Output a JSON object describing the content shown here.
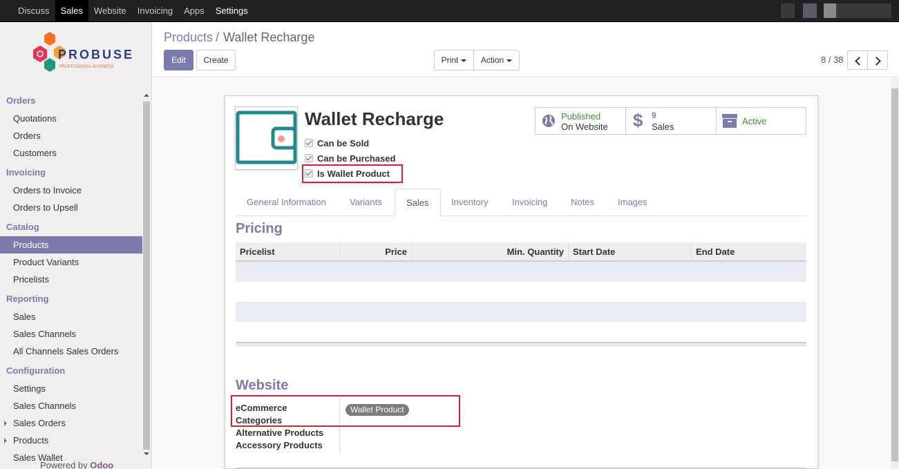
{
  "topbar": {
    "menu": [
      "Discuss",
      "Sales",
      "Website",
      "Invoicing",
      "Apps",
      "Settings"
    ],
    "active": "Sales"
  },
  "logo": {
    "name": "PROBUSE",
    "tagline": "PROFESSIONAL BUSINESS"
  },
  "sidebar": {
    "sections": [
      {
        "title": "Orders",
        "items": [
          "Quotations",
          "Orders",
          "Customers"
        ]
      },
      {
        "title": "Invoicing",
        "items": [
          "Orders to Invoice",
          "Orders to Upsell"
        ]
      },
      {
        "title": "Catalog",
        "items": [
          "Products",
          "Product Variants",
          "Pricelists"
        ]
      },
      {
        "title": "Reporting",
        "items": [
          "Sales",
          "Sales Channels",
          "All Channels Sales Orders"
        ]
      },
      {
        "title": "Configuration",
        "items": [
          "Settings",
          "Sales Channels",
          "Sales Orders",
          "Products",
          "Sales Wallet"
        ]
      }
    ],
    "active_item": "Products",
    "powered_prefix": "Powered by ",
    "powered_brand": "Odoo"
  },
  "control": {
    "breadcrumb_link": "Products",
    "breadcrumb_sep": "/",
    "breadcrumb_current": "Wallet Recharge",
    "edit": "Edit",
    "create": "Create",
    "print": "Print",
    "action": "Action",
    "pager": "8 / 38"
  },
  "product": {
    "name": "Wallet Recharge",
    "checkboxes": [
      "Can be Sold",
      "Can be Purchased",
      "Is Wallet Product"
    ]
  },
  "stats": {
    "published_1": "Published",
    "published_2": "On Website",
    "sales_count": "9",
    "sales_label": "Sales",
    "active": "Active"
  },
  "tabs": [
    "General Information",
    "Variants",
    "Sales",
    "Inventory",
    "Invoicing",
    "Notes",
    "Images"
  ],
  "active_tab": "Sales",
  "pricing": {
    "title": "Pricing",
    "columns": [
      "Pricelist",
      "Price",
      "Min. Quantity",
      "Start Date",
      "End Date"
    ]
  },
  "website": {
    "title": "Website",
    "ecommerce_label_1": "eCommerce",
    "ecommerce_label_2": "Categories",
    "category_tag": "Wallet Product",
    "alternative": "Alternative Products",
    "accessory": "Accessory Products"
  },
  "colors": {
    "accent": "#7c7bad",
    "published": "#3c8c3c",
    "highlight": "#e0202f"
  }
}
